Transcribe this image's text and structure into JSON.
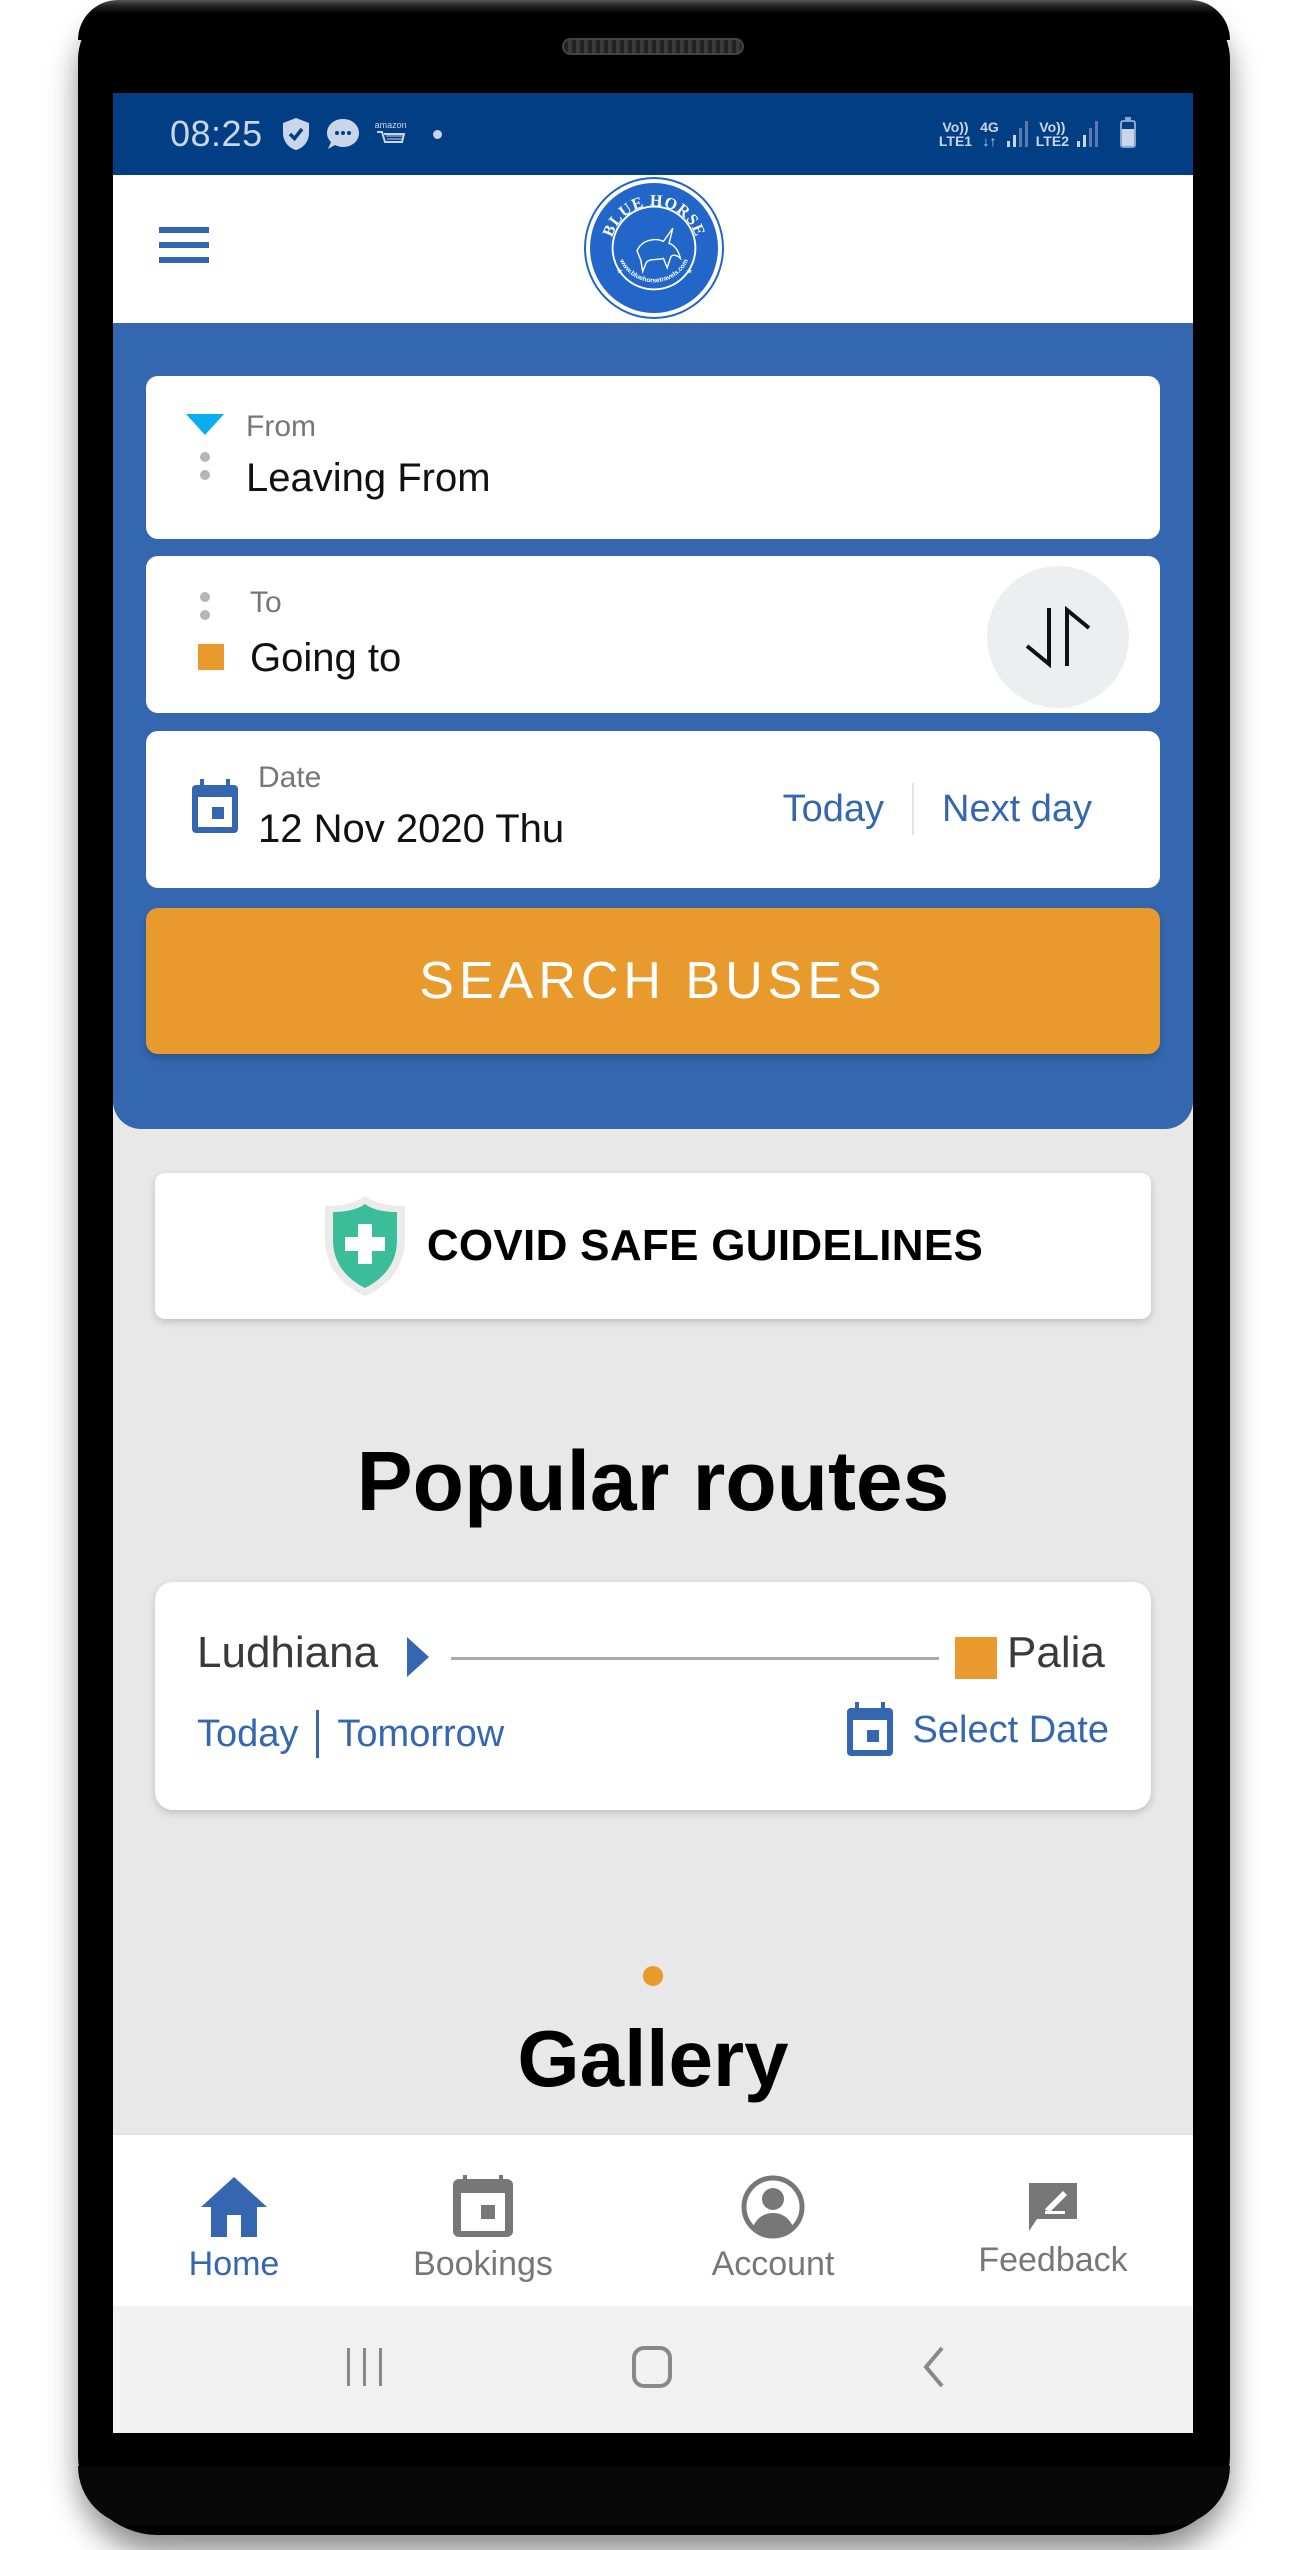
{
  "status_bar": {
    "time": "08:25",
    "left_icons": [
      "shield-check-icon",
      "chat-bubble-icon",
      "amazon-cart-icon",
      "dot-icon"
    ],
    "amazon_label": "amazon",
    "sim1": {
      "volte": "Vo))",
      "type": "LTE1"
    },
    "data": {
      "type": "4G",
      "arrows": "↓↑"
    },
    "sim2": {
      "volte": "Vo))",
      "type": "LTE2"
    },
    "battery": "charging"
  },
  "app_header": {
    "menu_icon": "hamburger-icon",
    "logo": {
      "title": "BLUE HORSE",
      "url_text": "www.bluehorsetravels.com"
    }
  },
  "search_form": {
    "from": {
      "label": "From",
      "placeholder": "Leaving From"
    },
    "to": {
      "label": "To",
      "placeholder": "Going to"
    },
    "swap_icon": "swap-vertical-icon",
    "date": {
      "label": "Date",
      "value": "12 Nov 2020 Thu",
      "today_label": "Today",
      "next_day_label": "Next day"
    },
    "search_button": "SEARCH BUSES"
  },
  "covid_banner": {
    "label": "COVID SAFE GUIDELINES",
    "icon": "shield-plus-icon"
  },
  "popular_routes": {
    "title": "Popular routes",
    "routes": [
      {
        "from": "Ludhiana",
        "to": "Palia",
        "today_label": "Today",
        "tomorrow_label": "Tomorrow",
        "select_date_label": "Select Date"
      }
    ],
    "carousel": {
      "count": 1,
      "active": 0
    }
  },
  "gallery": {
    "title": "Gallery"
  },
  "bottom_nav": {
    "items": [
      {
        "label": "Home",
        "icon": "home-icon",
        "active": true
      },
      {
        "label": "Bookings",
        "icon": "calendar-icon",
        "active": false
      },
      {
        "label": "Account",
        "icon": "account-circle-icon",
        "active": false
      },
      {
        "label": "Feedback",
        "icon": "feedback-icon",
        "active": false
      }
    ]
  },
  "system_nav": [
    "recent-apps",
    "home",
    "back"
  ],
  "colors": {
    "primary_blue": "#3567b0",
    "status_bar_blue": "#023e84",
    "accent_orange": "#e89b2c",
    "from_marker_cyan": "#0aaeee",
    "covid_green": "#3bbd9a",
    "background_grey": "#e8e8e8"
  }
}
